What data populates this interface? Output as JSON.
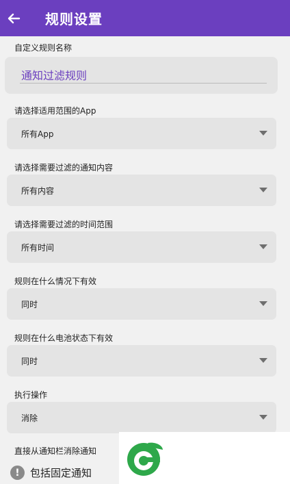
{
  "appbar": {
    "title": "规则设置"
  },
  "rule_name": {
    "label": "自定义规则名称",
    "value": "通知过滤规则"
  },
  "fields": [
    {
      "label": "请选择适用范围的App",
      "value": "所有App"
    },
    {
      "label": "请选择需要过滤的通知内容",
      "value": "所有内容"
    },
    {
      "label": "请选择需要过滤的时间范围",
      "value": "所有时间"
    },
    {
      "label": "规则在什么情况下有效",
      "value": "同时"
    },
    {
      "label": "规则在什么电池状态下有效",
      "value": "同时"
    },
    {
      "label": "执行操作",
      "value": "消除"
    }
  ],
  "dismiss_section": {
    "label": "直接从通知栏消除通知",
    "option": "包括固定通知"
  },
  "colors": {
    "accent": "#6b3fbf",
    "logo_green": "#2ea84a"
  },
  "icons": {
    "back": "arrow-left-icon",
    "dropdown": "caret-down-icon",
    "info": "exclamation-circle-icon"
  }
}
